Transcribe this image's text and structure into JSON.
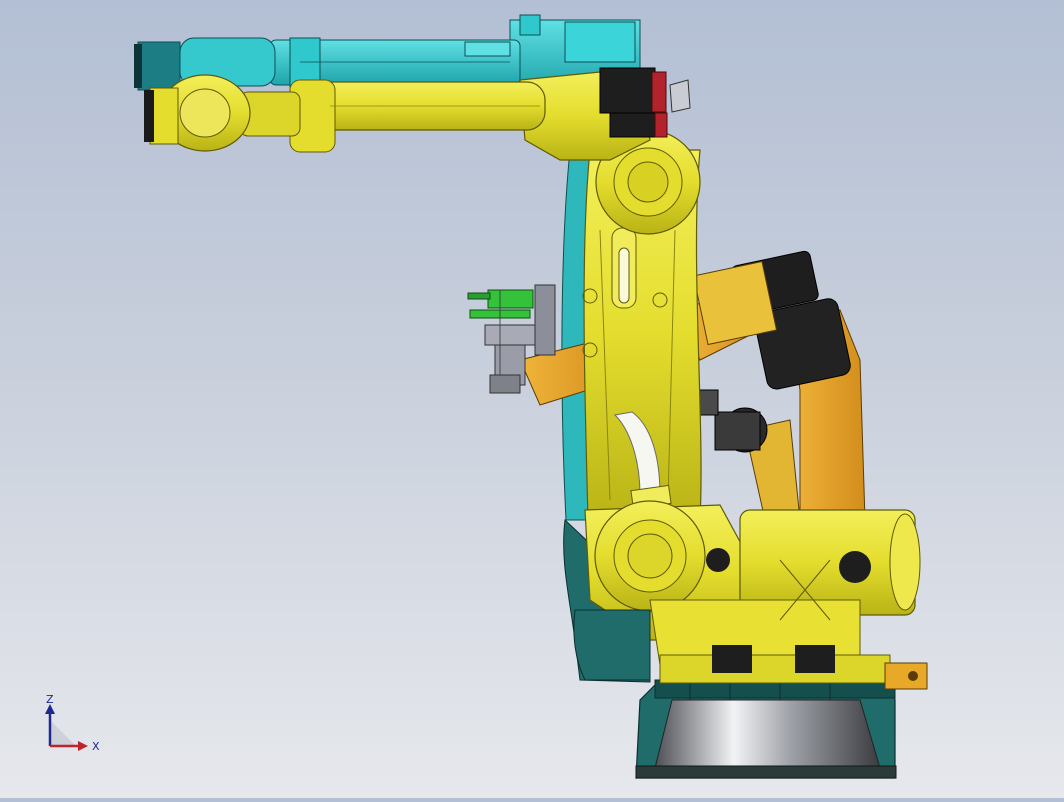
{
  "viewport": {
    "background_top": "#b3bfd4",
    "background_bottom": "#e6e8ec",
    "model": {
      "colors": {
        "yellow_arm": "#e6e033",
        "yellow_dark": "#b8b21a",
        "orange_arm": "#e8a928",
        "cyan_ghost": "#2fc8cc",
        "teal_base": "#1f6c6a",
        "black_motor": "#1e1e1e",
        "red_accent": "#b3232b",
        "green_tool": "#34c23a",
        "grey_tool": "#8c8f9a",
        "chrome": "#d9dbe0"
      }
    }
  },
  "triad": {
    "z_label": "Z",
    "x_label": "X",
    "z_color": "#1b2a8c",
    "x_color": "#c0232a"
  }
}
